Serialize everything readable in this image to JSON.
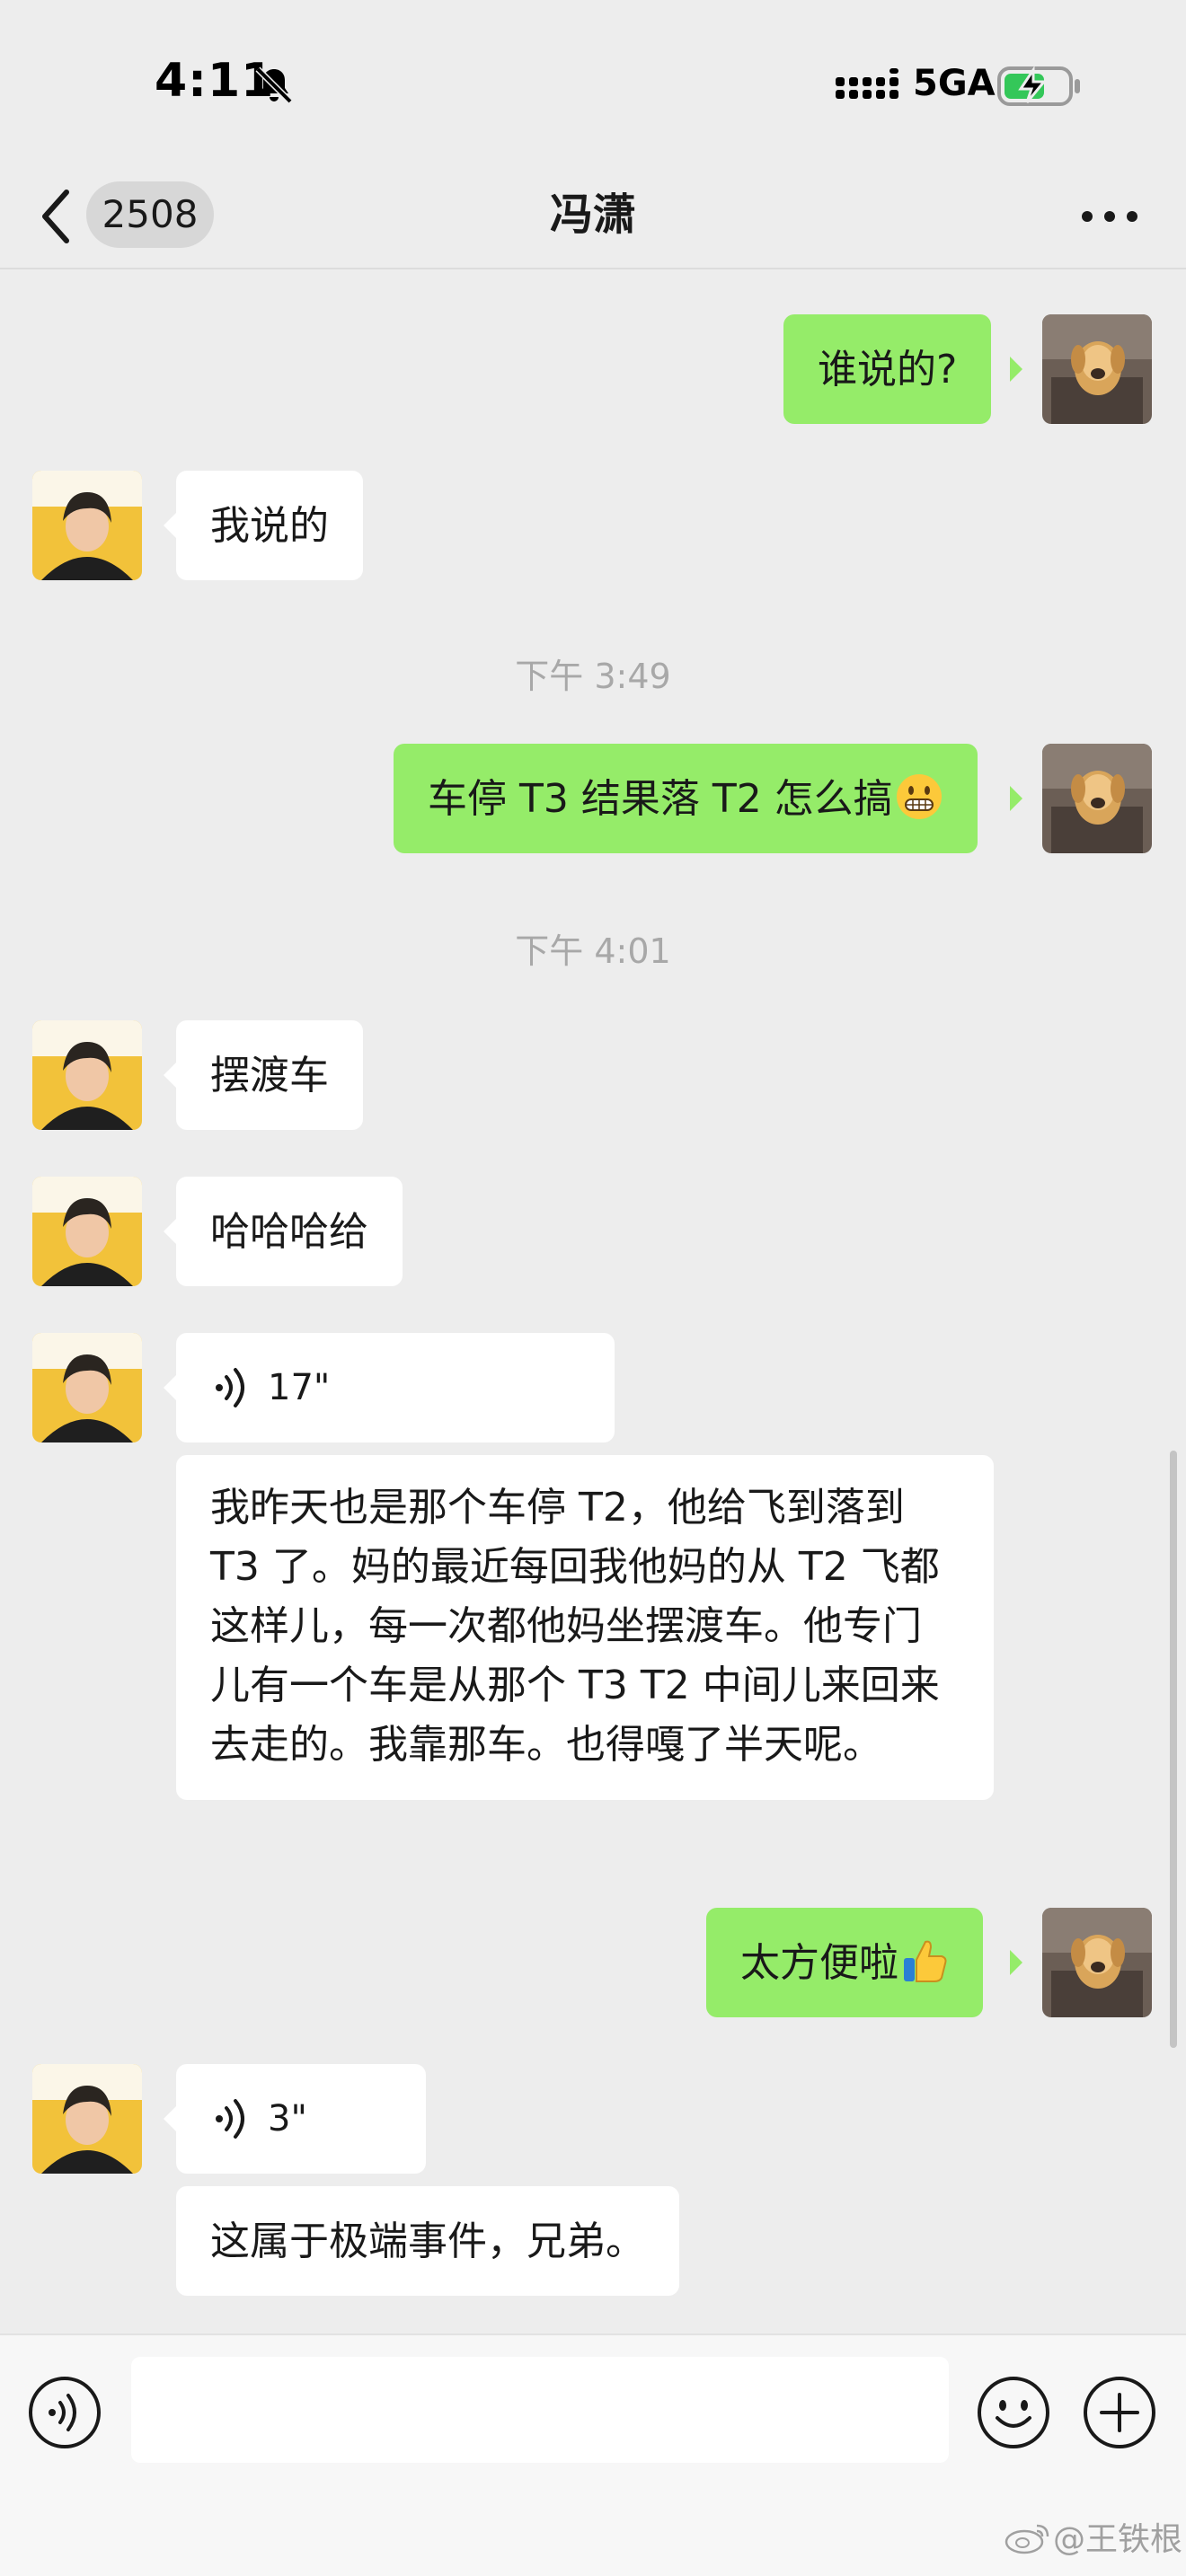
{
  "status_bar": {
    "time": "4:11",
    "network": "5GA",
    "icons": [
      "bell-off-icon",
      "signal-icon",
      "battery-charging-icon"
    ]
  },
  "nav": {
    "back_icon": "chevron-left-icon",
    "unread_count": "2508",
    "title": "冯潇",
    "more_icon": "more-horizontal-icon"
  },
  "messages": [
    {
      "side": "out",
      "type": "text",
      "text": "谁说的?"
    },
    {
      "side": "in",
      "type": "text",
      "text": "我说的"
    },
    {
      "type": "time",
      "text": "下午 3:49"
    },
    {
      "side": "out",
      "type": "text",
      "text": "车停 T3 结果落 T2 怎么搞",
      "emoji": "grimacing-face-emoji"
    },
    {
      "type": "time",
      "text": "下午 4:01"
    },
    {
      "side": "in",
      "type": "text",
      "text": "摆渡车"
    },
    {
      "side": "in",
      "type": "text",
      "text": "哈哈哈给"
    },
    {
      "side": "in",
      "type": "voice",
      "duration": "17\""
    },
    {
      "side": "in",
      "type": "transcript",
      "text": "我昨天也是那个车停 T2，他给飞到落到 T3 了。妈的最近每回我他妈的从 T2 飞都这样儿，每一次都他妈坐摆渡车。他专门儿有一个车是从那个 T3 T2 中间儿来回来去走的。我靠那车。也得嘎了半天呢。"
    },
    {
      "side": "out",
      "type": "text",
      "text": "太方便啦",
      "emoji": "thumbs-up-emoji"
    },
    {
      "side": "in",
      "type": "voice",
      "duration": "3\""
    },
    {
      "side": "in",
      "type": "transcript",
      "text": "这属于极端事件，兄弟。"
    }
  ],
  "input_bar": {
    "voice_icon": "voice-mode-icon",
    "placeholder": "",
    "emoji_icon": "smiley-icon",
    "plus_icon": "plus-circle-icon"
  },
  "watermark": {
    "text": "@王铁根",
    "icon": "weibo-icon"
  },
  "colors": {
    "background": "#ededed",
    "outgoing_bubble": "#95ec69",
    "incoming_bubble": "#ffffff",
    "timestamp": "#a8a8a8"
  }
}
